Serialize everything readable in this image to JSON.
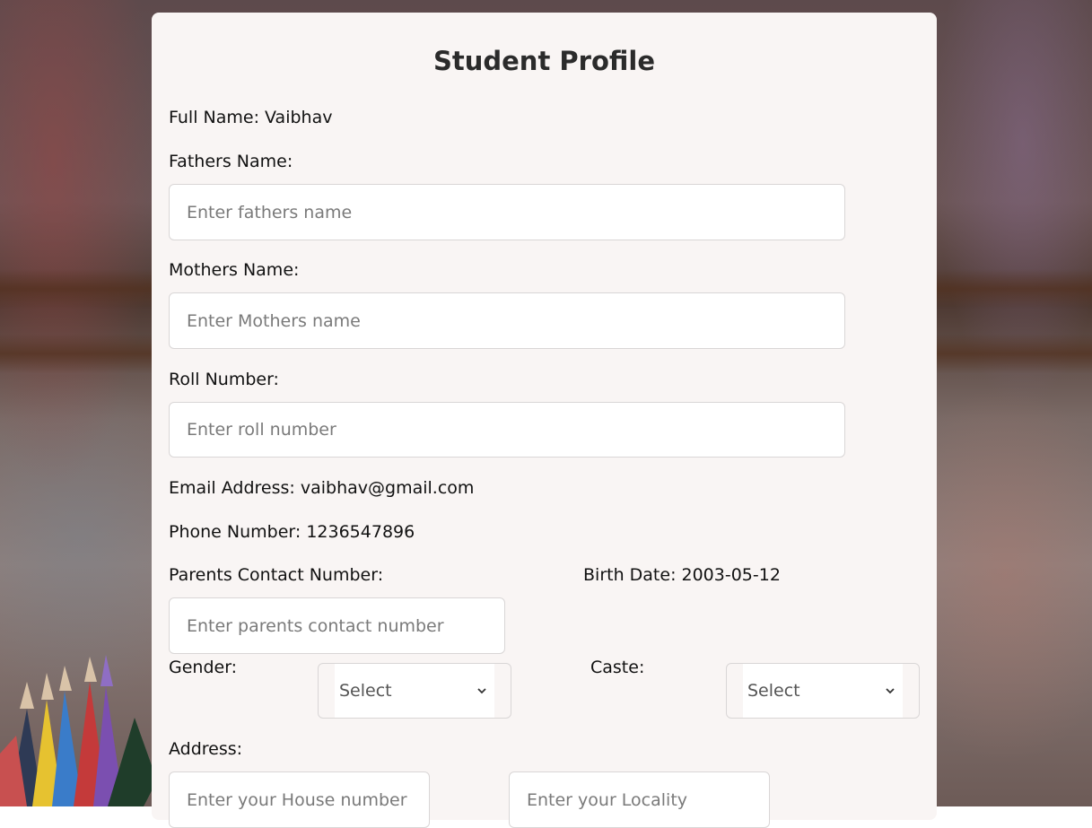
{
  "page": {
    "title": "Student Profile"
  },
  "profile": {
    "full_name_label": "Full Name: Vaibhav",
    "fathers_name_label": "Fathers Name:",
    "fathers_name_placeholder": "Enter fathers name",
    "mothers_name_label": "Mothers Name:",
    "mothers_name_placeholder": "Enter Mothers name",
    "roll_number_label": "Roll Number:",
    "roll_number_placeholder": "Enter roll number",
    "email_label": "Email Address: vaibhav@gmail.com",
    "phone_label": "Phone Number: 1236547896",
    "parents_contact_label": "Parents Contact Number:",
    "parents_contact_placeholder": "Enter parents contact number",
    "birth_date_label": "Birth Date: 2003-05-12",
    "gender_label": "Gender:",
    "gender_selected": "Select",
    "caste_label": "Caste:",
    "caste_selected": "Select",
    "address_label": "Address:",
    "house_placeholder": "Enter your House number",
    "locality_placeholder": "Enter your Locality"
  },
  "icons": {
    "select_chevron": "chevron-down-icon"
  },
  "colors": {
    "card_background": "#f9f5f4",
    "input_border": "#d9d6d6",
    "title_text": "#2b2b2b"
  }
}
